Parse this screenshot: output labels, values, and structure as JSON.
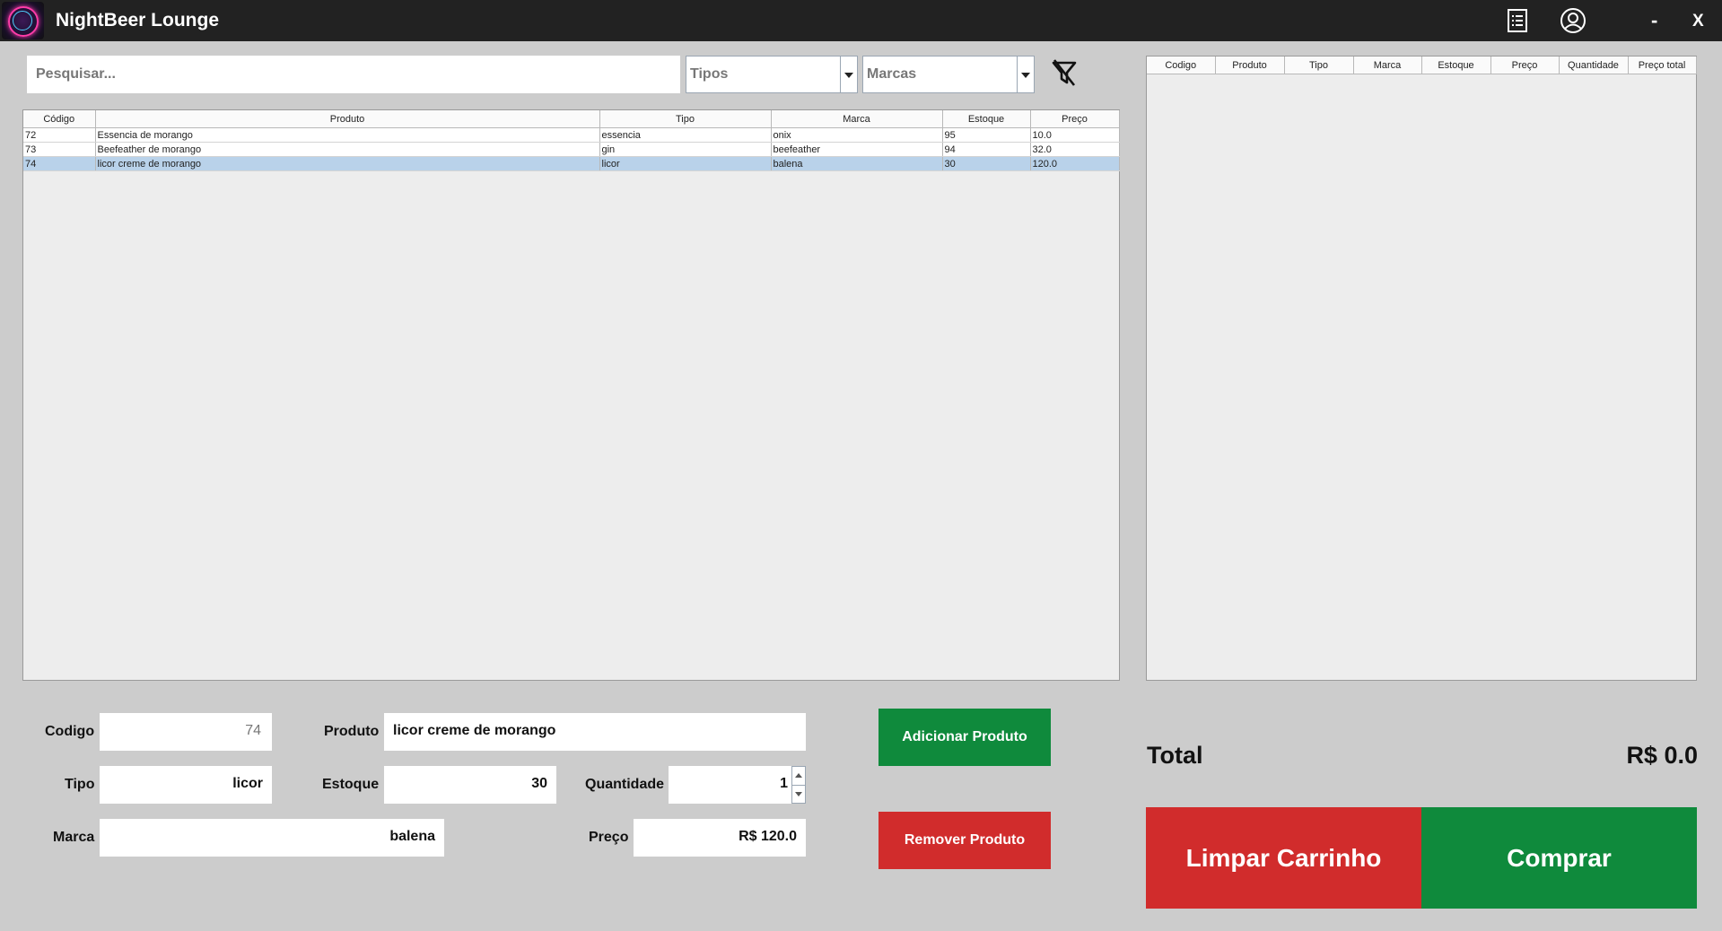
{
  "app": {
    "title": "NightBeer Lounge"
  },
  "titlebar": {
    "minimize_label": "-",
    "close_label": "X",
    "icons": [
      "receipt-list-icon",
      "user-profile-icon"
    ]
  },
  "search": {
    "placeholder": "Pesquisar..."
  },
  "filters": {
    "tipos_label": "Tipos",
    "marcas_label": "Marcas",
    "clear_icon": "filter-off-icon"
  },
  "products_table": {
    "columns": [
      "Código",
      "Produto",
      "Tipo",
      "Marca",
      "Estoque",
      "Preço"
    ],
    "rows": [
      [
        "72",
        "Essencia de morango",
        "essencia",
        "onix",
        "95",
        "10.0"
      ],
      [
        "73",
        "Beefeather de morango",
        "gin",
        "beefeather",
        "94",
        "32.0"
      ],
      [
        "74",
        "licor creme de morango",
        "licor",
        "balena",
        "30",
        "120.0"
      ]
    ],
    "selected_row": 2
  },
  "cart_table": {
    "columns": [
      "Codigo",
      "Produto",
      "Tipo",
      "Marca",
      "Estoque",
      "Preço",
      "Quantidade",
      "Preço total"
    ],
    "rows": []
  },
  "form": {
    "codigo_label": "Codigo",
    "codigo_value": "74",
    "produto_label": "Produto",
    "produto_value": "licor creme de morango",
    "tipo_label": "Tipo",
    "tipo_value": "licor",
    "estoque_label": "Estoque",
    "estoque_value": "30",
    "quantidade_label": "Quantidade",
    "quantidade_value": "1",
    "marca_label": "Marca",
    "marca_value": "balena",
    "preco_label": "Preço",
    "preco_value": "R$ 120.0"
  },
  "actions": {
    "add_label": "Adicionar Produto",
    "remove_label": "Remover Produto",
    "clear_cart_label": "Limpar Carrinho",
    "buy_label": "Comprar"
  },
  "totals": {
    "label": "Total",
    "value": "R$ 0.0"
  },
  "colors": {
    "green": "#0f8a3c",
    "red": "#d12c2c",
    "titlebar": "#222222",
    "background": "#cccccc",
    "selection": "#b9d2ea"
  }
}
